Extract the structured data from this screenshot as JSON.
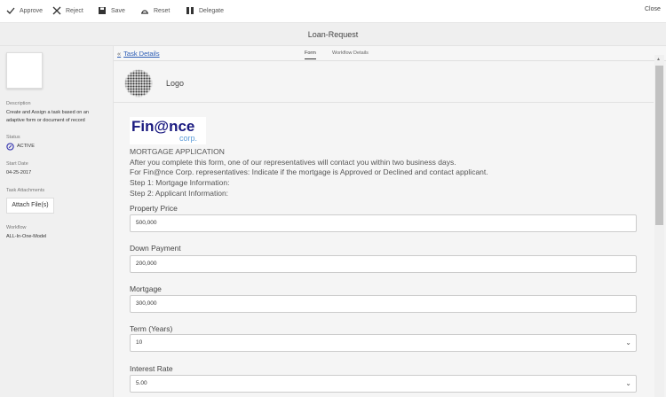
{
  "toolbar": {
    "approve": "Approve",
    "reject": "Reject",
    "save": "Save",
    "reset": "Reset",
    "delegate": "Delegate",
    "close": "Close"
  },
  "title": "Loan-Request",
  "sidebar": {
    "description_label": "Description",
    "description": "Create and Assign a task based on an adaptive form or document of record",
    "status_label": "Status",
    "status": "ACTIVE",
    "start_date_label": "Start Date",
    "start_date": "04-25-2017",
    "attachments_label": "Task Attachments",
    "attach_button": "Attach File(s)",
    "workflow_label": "Workflow",
    "workflow": "ALL-In-One-Model"
  },
  "nav": {
    "back": "Task Details",
    "tabs": [
      "Form",
      "Workflow Details"
    ]
  },
  "form": {
    "logo_text": "Logo",
    "brand_main": "Fin@nce",
    "brand_sub": "corp.",
    "intro": [
      "MORTGAGE APPLICATION",
      "After you complete this form, one of our representatives will contact you within two business days.",
      "For Fin@nce Corp. representatives: Indicate if the mortgage is Approved or Declined and contact applicant.",
      "Step 1: Mortgage Information:",
      "Step 2: Applicant Information:"
    ],
    "fields": [
      {
        "label": "Property Price",
        "value": "500,000"
      },
      {
        "label": "Down Payment",
        "value": "200,000"
      },
      {
        "label": "Mortgage",
        "value": "300,000"
      },
      {
        "label": "Term (Years)",
        "value": "10"
      },
      {
        "label": "Interest Rate",
        "value": "5.00"
      }
    ]
  },
  "colors": {
    "accent": "#2a5bb5",
    "status": "#3a3ab0"
  }
}
